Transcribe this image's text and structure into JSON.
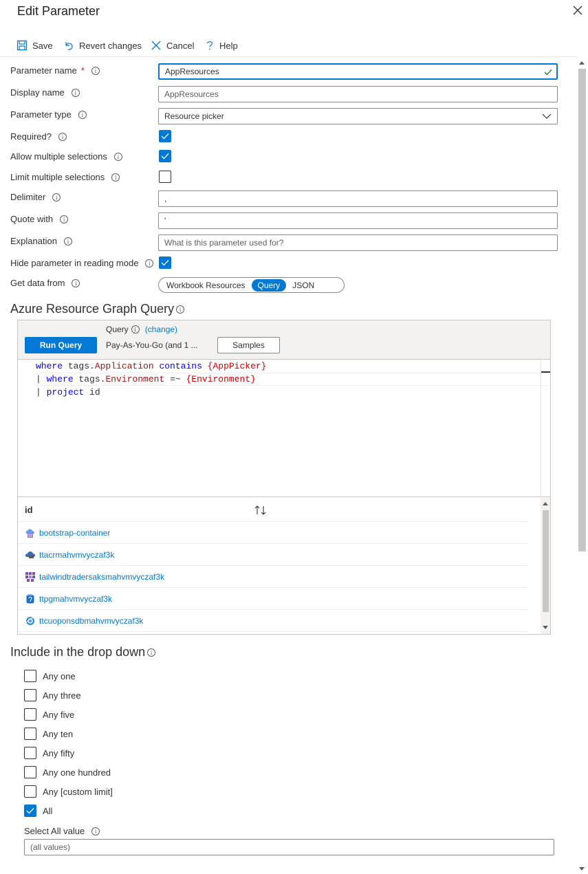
{
  "title": "Edit Parameter",
  "toolbar": {
    "save": "Save",
    "revert": "Revert changes",
    "cancel": "Cancel",
    "help": "Help"
  },
  "form": {
    "param_name_label": "Parameter name",
    "param_name_required": "*",
    "param_name_value": "AppResources",
    "display_name_label": "Display name",
    "display_name_placeholder": "AppResources",
    "param_type_label": "Parameter type",
    "param_type_value": "Resource picker",
    "required_label": "Required?",
    "required_checked": true,
    "allow_multi_label": "Allow multiple selections",
    "allow_multi_checked": true,
    "limit_multi_label": "Limit multiple selections",
    "limit_multi_checked": false,
    "delimiter_label": "Delimiter",
    "delimiter_value": ",",
    "quote_label": "Quote with",
    "quote_value": "'",
    "explanation_label": "Explanation",
    "explanation_placeholder": "What is this parameter used for?",
    "hide_label": "Hide parameter in reading mode",
    "hide_checked": true,
    "get_data_label": "Get data from",
    "get_data_options": [
      "Workbook Resources",
      "Query",
      "JSON"
    ],
    "get_data_selected": "Query"
  },
  "query_section": {
    "heading": "Azure Resource Graph Query",
    "query_label": "Query",
    "change_link": "(change)",
    "run_button": "Run Query",
    "subscription": "Pay-As-You-Go (and 1 ...",
    "samples_button": "Samples",
    "code_lines": [
      [
        {
          "t": "where",
          "c": "kw"
        },
        {
          "t": " tags.",
          "c": ""
        },
        {
          "t": "Application",
          "c": "prop"
        },
        {
          "t": " contains ",
          "c": "kw"
        },
        {
          "t": "{AppPicker}",
          "c": "tok"
        }
      ],
      [
        {
          "t": "| ",
          "c": ""
        },
        {
          "t": "where",
          "c": "kw"
        },
        {
          "t": " tags.",
          "c": ""
        },
        {
          "t": "Environment",
          "c": "prop"
        },
        {
          "t": " =~ ",
          "c": ""
        },
        {
          "t": "{Environment}",
          "c": "tok"
        }
      ],
      [
        {
          "t": "| ",
          "c": ""
        },
        {
          "t": "project",
          "c": "kw"
        },
        {
          "t": " id",
          "c": ""
        }
      ]
    ],
    "grid_header": "id",
    "results": [
      {
        "name": "bootstrap-container",
        "icon": "container-instance-icon",
        "color": "#5ea0ef"
      },
      {
        "name": "ttacrmahvmvyczaf3k",
        "icon": "container-registry-icon",
        "color": "#3e6fb5"
      },
      {
        "name": "tailwindtradersaksmahvmvyczaf3k",
        "icon": "kubernetes-service-icon",
        "color": "#7b4fb6"
      },
      {
        "name": "ttpgmahvmvyczaf3k",
        "icon": "postgresql-icon",
        "color": "#1f6fc5"
      },
      {
        "name": "ttcuoponsdbmahvmvyczaf3k",
        "icon": "cosmos-db-icon",
        "color": "#2a8ad4"
      }
    ]
  },
  "dropdown_section": {
    "heading": "Include in the drop down",
    "items": [
      {
        "label": "Any one",
        "checked": false
      },
      {
        "label": "Any three",
        "checked": false
      },
      {
        "label": "Any five",
        "checked": false
      },
      {
        "label": "Any ten",
        "checked": false
      },
      {
        "label": "Any fifty",
        "checked": false
      },
      {
        "label": "Any one hundred",
        "checked": false
      },
      {
        "label": "Any [custom limit]",
        "checked": false
      },
      {
        "label": "All",
        "checked": true
      }
    ],
    "select_all_label": "Select All value",
    "select_all_placeholder": "(all values)"
  },
  "colors": {
    "accent": "#0078d4",
    "valid": "#107c10"
  }
}
